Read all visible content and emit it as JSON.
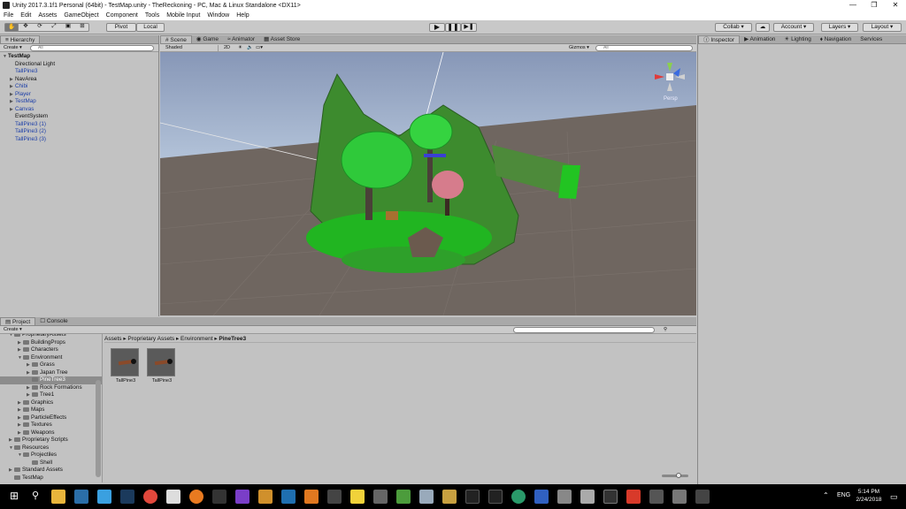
{
  "window": {
    "title": "Unity 2017.3.1f1 Personal (64bit) - TestMap.unity - TheReckoning - PC, Mac & Linux Standalone <DX11>"
  },
  "menu": [
    "File",
    "Edit",
    "Assets",
    "GameObject",
    "Component",
    "Tools",
    "Mobile Input",
    "Window",
    "Help"
  ],
  "toolbar": {
    "pivot": "Pivot",
    "local": "Local",
    "collab": "Collab",
    "account": "Account",
    "layers": "Layers",
    "layout": "Layout"
  },
  "hierarchy": {
    "tab": "Hierarchy",
    "create": "Create",
    "search_placeholder": "All",
    "scene": "TestMap",
    "items": [
      {
        "label": "Directional Light",
        "blue": false,
        "arrow": false
      },
      {
        "label": "TallPine3",
        "blue": true,
        "arrow": false
      },
      {
        "label": "NavArea",
        "blue": false,
        "arrow": true
      },
      {
        "label": "Chibi",
        "blue": true,
        "arrow": true
      },
      {
        "label": "Player",
        "blue": true,
        "arrow": true
      },
      {
        "label": "TestMap",
        "blue": true,
        "arrow": true
      },
      {
        "label": "Canvas",
        "blue": true,
        "arrow": true
      },
      {
        "label": "EventSystem",
        "blue": false,
        "arrow": false
      },
      {
        "label": "TallPine3 (1)",
        "blue": true,
        "arrow": false
      },
      {
        "label": "TallPine3 (2)",
        "blue": true,
        "arrow": false
      },
      {
        "label": "TallPine3 (3)",
        "blue": true,
        "arrow": false
      }
    ]
  },
  "scene_view": {
    "tabs": [
      "Scene",
      "Game",
      "Animator",
      "Asset Store"
    ],
    "shading": "Shaded",
    "mode_2d": "2D",
    "gizmos": "Gizmos",
    "search_placeholder": "All",
    "persp": "Persp"
  },
  "inspector": {
    "tabs": [
      "Inspector",
      "Animation",
      "Lighting",
      "Navigation",
      "Services"
    ]
  },
  "project": {
    "tabs": [
      "Project",
      "Console"
    ],
    "create": "Create",
    "tree": [
      {
        "label": "ProprietaryAssets",
        "indent": 0,
        "arrow": "▼"
      },
      {
        "label": "BuildingProps",
        "indent": 1,
        "arrow": "▶"
      },
      {
        "label": "Characters",
        "indent": 1,
        "arrow": "▶"
      },
      {
        "label": "Environment",
        "indent": 1,
        "arrow": "▼"
      },
      {
        "label": "Grass",
        "indent": 2,
        "arrow": "▶"
      },
      {
        "label": "Japan Tree",
        "indent": 2,
        "arrow": "▶"
      },
      {
        "label": "PineTree3",
        "indent": 2,
        "arrow": "",
        "selected": true
      },
      {
        "label": "Rock Formations",
        "indent": 2,
        "arrow": "▶"
      },
      {
        "label": "Tree1",
        "indent": 2,
        "arrow": "▶"
      },
      {
        "label": "Graphics",
        "indent": 1,
        "arrow": "▶"
      },
      {
        "label": "Maps",
        "indent": 1,
        "arrow": "▶"
      },
      {
        "label": "ParticleEffects",
        "indent": 1,
        "arrow": "▶"
      },
      {
        "label": "Textures",
        "indent": 1,
        "arrow": "▶"
      },
      {
        "label": "Weapons",
        "indent": 1,
        "arrow": "▶"
      },
      {
        "label": "Proprietary Scripts",
        "indent": 0,
        "arrow": "▶"
      },
      {
        "label": "Resources",
        "indent": 0,
        "arrow": "▼"
      },
      {
        "label": "Projectiles",
        "indent": 1,
        "arrow": "▼"
      },
      {
        "label": "Shell",
        "indent": 2,
        "arrow": ""
      },
      {
        "label": "Standard Assets",
        "indent": 0,
        "arrow": "▶"
      },
      {
        "label": "TestMap",
        "indent": 0,
        "arrow": ""
      }
    ],
    "breadcrumb": [
      "Assets",
      "Proprietary Assets",
      "Environment",
      "PineTree3"
    ],
    "assets": [
      "TallPine3",
      "TallPine3"
    ]
  },
  "taskbar": {
    "lang": "ENG",
    "time": "5:14 PM",
    "date": "2/24/2018"
  },
  "colors": {
    "green": "#2ecc2e",
    "scene_ground": "#6f6660",
    "sky_top": "#9fb3d3"
  }
}
